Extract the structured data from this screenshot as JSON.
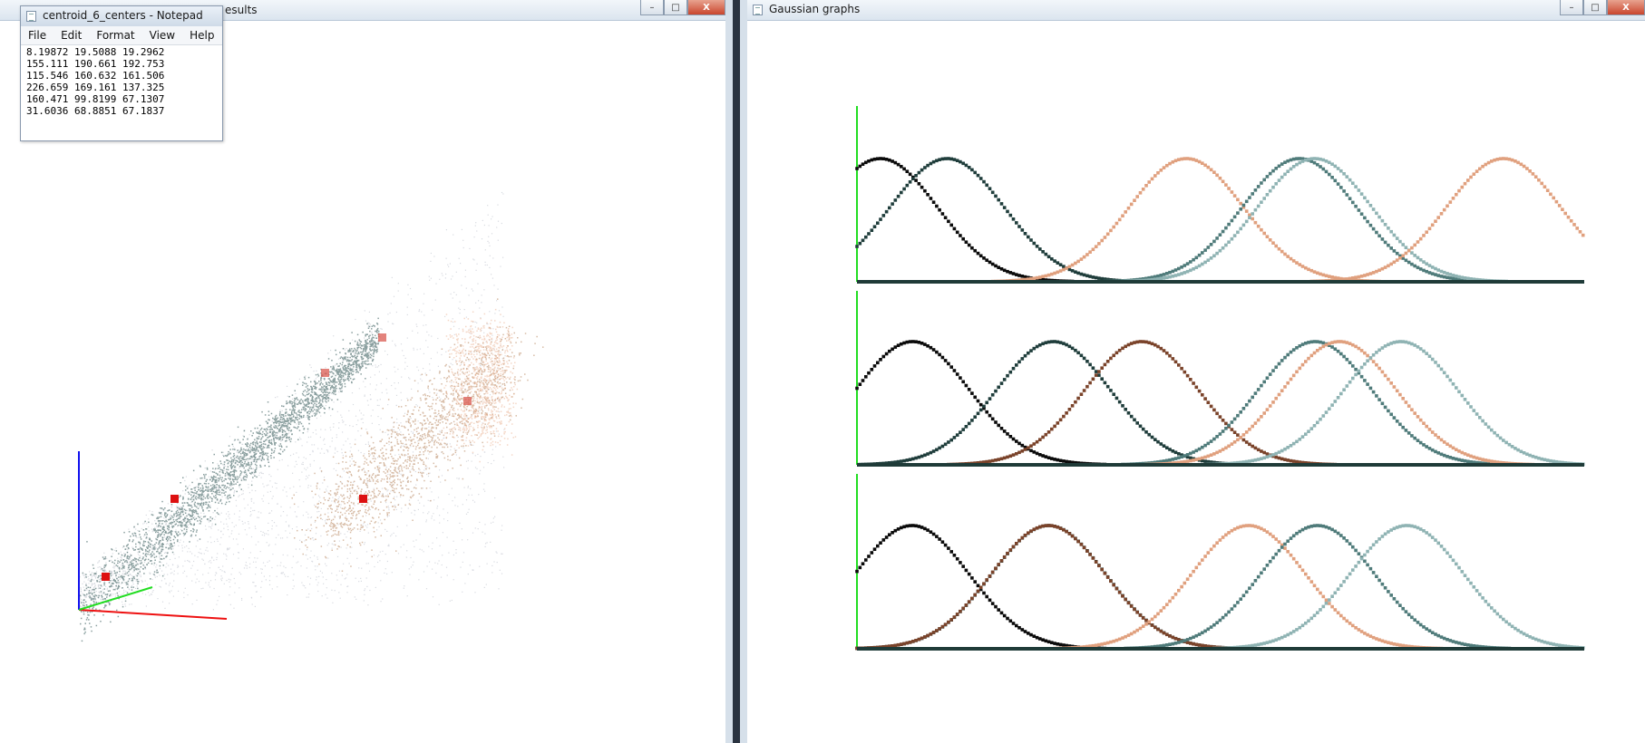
{
  "left_window": {
    "title_fragment": "esults",
    "buttons": {
      "minimize": "–",
      "maximize": "□",
      "close": "X"
    }
  },
  "notepad": {
    "title": "centroid_6_centers - Notepad",
    "menu": [
      "File",
      "Edit",
      "Format",
      "View",
      "Help"
    ],
    "lines": [
      "8.19872 19.5088 19.2962",
      "155.111 190.661 192.753",
      "115.546 160.632 161.506",
      "226.659 169.161 137.325",
      "160.471 99.8199 67.1307",
      "31.6036 68.8851 67.1837"
    ]
  },
  "right_window": {
    "title": "Gaussian graphs",
    "buttons": {
      "minimize": "–",
      "maximize": "□",
      "close": "X"
    }
  },
  "colors": {
    "axis_green": "#22dd22",
    "baseline": "#1f3b38",
    "black": "#0a0a0a",
    "dark_teal": "#1f3d3b",
    "teal": "#4f7b7a",
    "light_teal": "#8fb3b3",
    "brown": "#7a432a",
    "peach": "#e0a07e",
    "red_marker": "#dd1111",
    "axis_blue": "#1010ee",
    "axis_red": "#ee1111"
  },
  "gaussian_rows": [
    {
      "peaks": [
        {
          "mu": 8.2,
          "sigma": 20,
          "color": "black"
        },
        {
          "mu": 31.6,
          "sigma": 20,
          "color": "dark_teal"
        },
        {
          "mu": 115.5,
          "sigma": 20,
          "color": "peach"
        },
        {
          "mu": 155.1,
          "sigma": 20,
          "color": "teal"
        },
        {
          "mu": 160.5,
          "sigma": 20,
          "color": "light_teal"
        },
        {
          "mu": 226.7,
          "sigma": 20,
          "color": "peach"
        }
      ]
    },
    {
      "peaks": [
        {
          "mu": 19.5,
          "sigma": 20,
          "color": "black"
        },
        {
          "mu": 68.9,
          "sigma": 20,
          "color": "dark_teal"
        },
        {
          "mu": 99.8,
          "sigma": 20,
          "color": "brown"
        },
        {
          "mu": 160.6,
          "sigma": 20,
          "color": "teal"
        },
        {
          "mu": 169.2,
          "sigma": 20,
          "color": "peach"
        },
        {
          "mu": 190.7,
          "sigma": 20,
          "color": "light_teal"
        }
      ]
    },
    {
      "peaks": [
        {
          "mu": 19.3,
          "sigma": 20,
          "color": "black"
        },
        {
          "mu": 67.2,
          "sigma": 20,
          "color": "dark_teal"
        },
        {
          "mu": 67.1,
          "sigma": 20,
          "color": "brown"
        },
        {
          "mu": 137.3,
          "sigma": 20,
          "color": "peach"
        },
        {
          "mu": 161.5,
          "sigma": 20,
          "color": "teal"
        },
        {
          "mu": 192.8,
          "sigma": 20,
          "color": "light_teal"
        }
      ]
    }
  ]
}
